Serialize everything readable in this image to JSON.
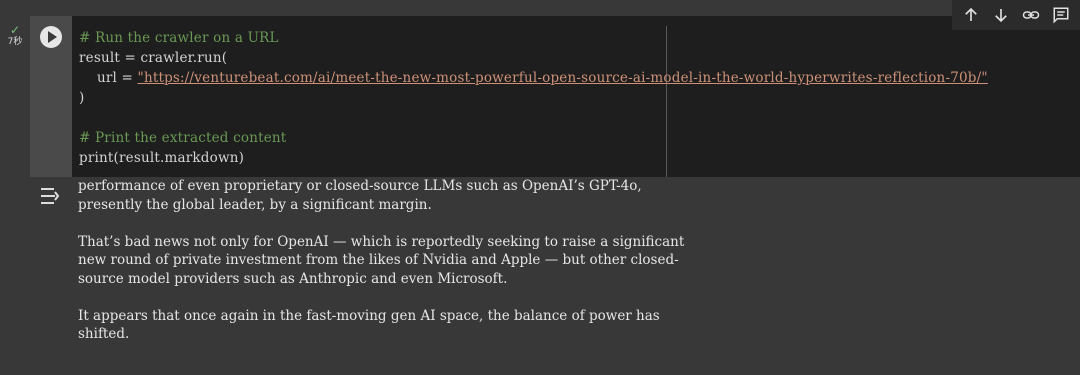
{
  "exec": {
    "check": "✓",
    "time": "7秒"
  },
  "code": {
    "line1": "# Run the crawler on a URL",
    "line2": "result = crawler.run(",
    "line3_prefix": "    url = ",
    "line3_url": "\"https://venturebeat.com/ai/meet-the-new-most-powerful-open-source-ai-model-in-the-world-hyperwrites-reflection-70b/\"",
    "line4": ")",
    "line6": "# Print the extracted content",
    "line7": "print(result.markdown)"
  },
  "toolbar": {
    "items": [
      {
        "name": "move-up",
        "icon": "arrow-up-icon"
      },
      {
        "name": "move-down",
        "icon": "arrow-down-icon"
      },
      {
        "name": "link",
        "icon": "link-icon"
      },
      {
        "name": "comment",
        "icon": "comment-icon"
      }
    ]
  },
  "output": {
    "p1": "performance of even proprietary or closed-source LLMs such as OpenAI’s GPT-4o, presently the global leader, by a significant margin.",
    "p2": "That’s bad news not only for OpenAI — which is reportedly seeking to raise a significant new round of private investment from the likes of Nvidia and Apple — but other closed-source model providers such as Anthropic and even Microsoft.",
    "p3": "It appears that once again in the fast-moving gen AI space, the balance of power has shifted."
  },
  "colors": {
    "background": "#383838",
    "code_bg": "#1e1e1e",
    "comment": "#6a9955",
    "string": "#ce9178"
  }
}
